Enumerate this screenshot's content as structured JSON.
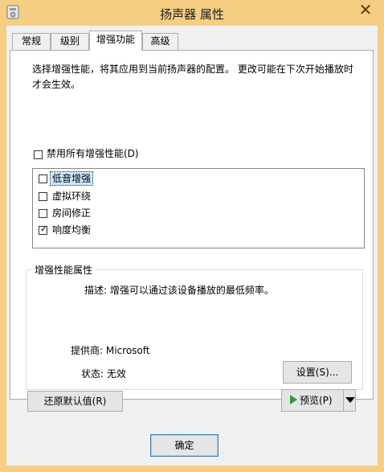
{
  "window": {
    "title": "扬声器 属性",
    "close_glyph": "✕"
  },
  "tabs": [
    {
      "label": "常规",
      "active": false
    },
    {
      "label": "级别",
      "active": false
    },
    {
      "label": "增强功能",
      "active": true
    },
    {
      "label": "高级",
      "active": false
    }
  ],
  "description": "选择增强性能，将其应用到当前扬声器的配置。 更改可能在下次开始播放时才会生效。",
  "disable_all": {
    "label": "禁用所有增强性能(D)",
    "checked": false
  },
  "enhancements": [
    {
      "label": "低音增强",
      "checked": false,
      "selected": true
    },
    {
      "label": "虚拟环绕",
      "checked": false,
      "selected": false
    },
    {
      "label": "房间修正",
      "checked": false,
      "selected": false
    },
    {
      "label": "响度均衡",
      "checked": true,
      "selected": false
    }
  ],
  "properties": {
    "group_title": "增强性能属性",
    "description": "描述: 增强可以通过该设备播放的最低频率。",
    "provider": "提供商: Microsoft",
    "status": "状态: 无效",
    "settings_button": "设置(S)..."
  },
  "buttons": {
    "restore_defaults": "还原默认值(R)",
    "preview": "预览(P)",
    "ok": "确定"
  },
  "icons": {
    "check": "✓",
    "close": "close-icon",
    "play": "play-icon",
    "dropdown": "chevron-down-icon"
  },
  "colors": {
    "frame": "#f5cd83",
    "play": "#2e9b37",
    "selection": "#cce8ff"
  }
}
